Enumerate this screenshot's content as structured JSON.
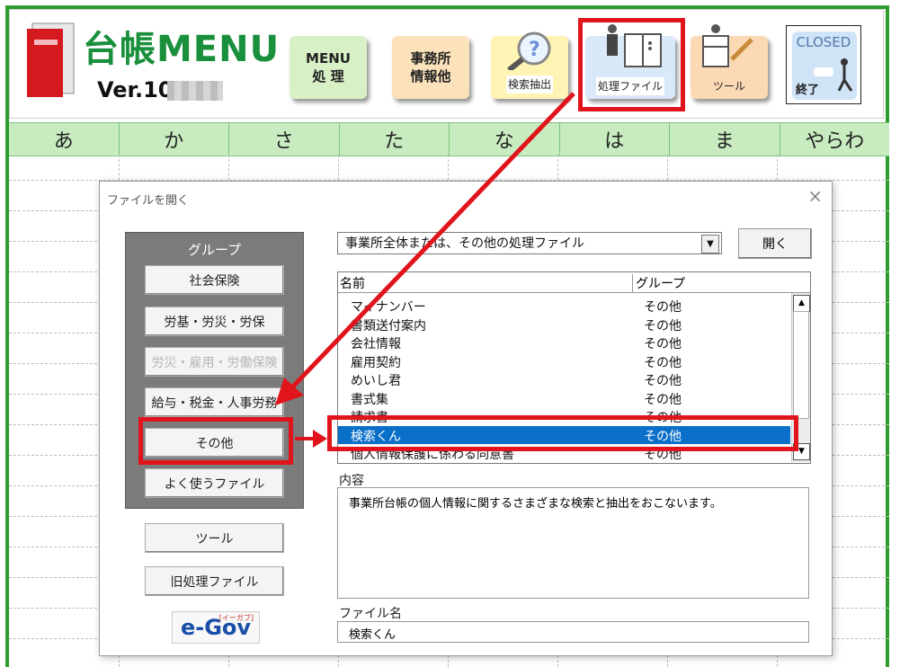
{
  "header": {
    "title": "台帳MENU",
    "version": "Ver.10.",
    "buttons": {
      "menu": [
        "MENU",
        "処 理"
      ],
      "office": [
        "事務所",
        "情報他"
      ],
      "search": "検索抽出",
      "proc": "処理ファイル",
      "tool": "ツール",
      "closed_top": "CLOSED",
      "closed_bottom": "終了"
    }
  },
  "kana_row": [
    "あ",
    "か",
    "さ",
    "た",
    "な",
    "は",
    "ま",
    "やらわ"
  ],
  "dialog": {
    "title": "ファイルを開く",
    "group_label": "グループ",
    "group_buttons": [
      "社会保険",
      "労基・労災・労保",
      "労災・雇用・労働保険",
      "給与・税金・人事労務",
      "その他",
      "よく使うファイル"
    ],
    "lower_buttons": [
      "ツール",
      "旧処理ファイル"
    ],
    "egov": "e-Gov",
    "egov_small": "[イーガブ]",
    "combo_value": "事業所全体または、その他の処理ファイル",
    "open_label": "開く",
    "list_headers": {
      "name": "名前",
      "group": "グループ"
    },
    "list_rows": [
      {
        "name": "マイナンバー",
        "group": "その他"
      },
      {
        "name": "書類送付案内",
        "group": "その他"
      },
      {
        "name": "会社情報",
        "group": "その他"
      },
      {
        "name": "雇用契約",
        "group": "その他"
      },
      {
        "name": "めいし君",
        "group": "その他"
      },
      {
        "name": "書式集",
        "group": "その他"
      },
      {
        "name": "請求書",
        "group": "その他"
      },
      {
        "name": "検索くん",
        "group": "その他"
      },
      {
        "name": "個人情報保護に係わる同意書",
        "group": "その他"
      }
    ],
    "selected_index": 7,
    "content_label": "内容",
    "content_text": "事業所台帳の個人情報に関するさまざまな検索と抽出をおこないます。",
    "filename_label": "ファイル名",
    "filename_value": "検索くん"
  },
  "colors": {
    "frame": "#2e9c2e",
    "highlight": "#e0141a",
    "selected": "#0a6fc9",
    "kana_bg": "#c8ecbf"
  }
}
